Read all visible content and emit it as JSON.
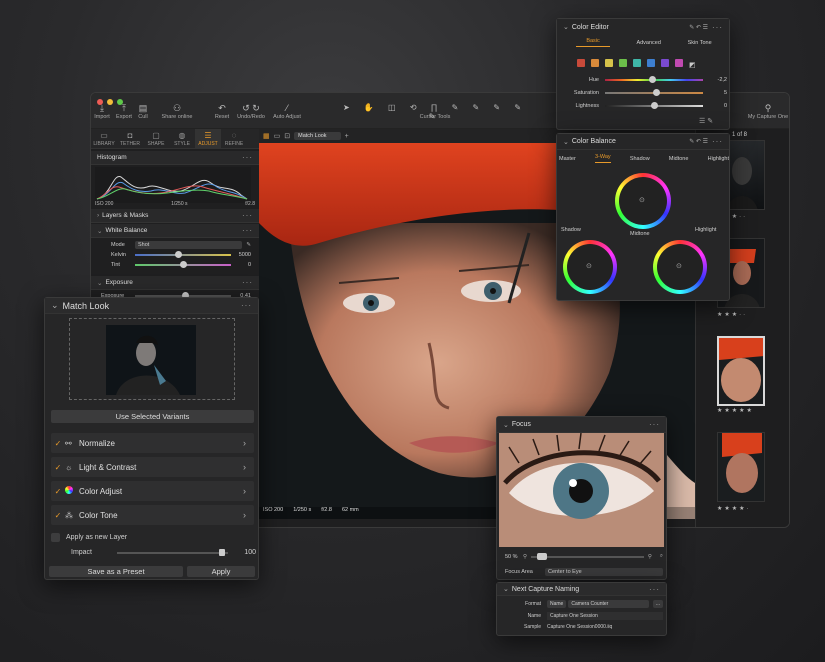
{
  "toolbar": {
    "import": "Import",
    "export": "Export",
    "cull": "Cull",
    "share": "Share online",
    "reset": "Reset",
    "undo_redo": "Undo/Redo",
    "auto_adjust": "Auto Adjust",
    "cursor_tools": "Cursor Tools",
    "my_capture_one": "My Capture One"
  },
  "tool_tabs": [
    "LIBRARY",
    "TETHER",
    "SHAPE",
    "STYLE",
    "ADJUST",
    "REFINE"
  ],
  "viewer_bar": {
    "match_look_select": "Match Look"
  },
  "histogram": {
    "title": "Histogram",
    "iso": "ISO 200",
    "shutter": "1/250 s",
    "aperture": "f/2.8"
  },
  "layers": {
    "title": "Layers & Masks"
  },
  "white_balance": {
    "title": "White Balance",
    "mode_label": "Mode",
    "mode_value": "Shot",
    "kelvin_label": "Kelvin",
    "kelvin_value": "5000",
    "kelvin_level": 0.45,
    "tint_label": "Tint",
    "tint_value": "0",
    "tint_level": 0.5
  },
  "exposure": {
    "title": "Exposure",
    "label": "Exposure",
    "value": "0,41",
    "level": 0.52
  },
  "match_look": {
    "title": "Match Look",
    "use_variants": "Use Selected Variants",
    "items": [
      {
        "label": "Normalize",
        "icon": "normalize-icon"
      },
      {
        "label": "Light & Contrast",
        "icon": "sun-icon"
      },
      {
        "label": "Color Adjust",
        "icon": "color-wheel-icon"
      },
      {
        "label": "Color Tone",
        "icon": "color-tone-icon"
      }
    ],
    "apply_layer": "Apply as new Layer",
    "impact_label": "Impact",
    "impact_value": "100",
    "impact_level": 0.95,
    "save_preset": "Save as a Preset",
    "apply": "Apply"
  },
  "viewer_status": {
    "iso": "ISO 200",
    "shutter": "1/250 s",
    "aperture": "f/2.8",
    "focal": "62 mm"
  },
  "color_editor": {
    "title": "Color Editor",
    "tabs": [
      "Basic",
      "Advanced",
      "Skin Tone"
    ],
    "swatches": [
      "#c84a3a",
      "#d98a3a",
      "#d6c24a",
      "#6cbf4a",
      "#3fb7a8",
      "#3d7fd0",
      "#7a4ad0",
      "#c04ab0"
    ],
    "hue_label": "Hue",
    "hue_value": "-2,2",
    "hue_level": 0.48,
    "sat_label": "Saturation",
    "sat_value": "5",
    "sat_level": 0.52,
    "light_label": "Lightness",
    "light_value": "0",
    "light_level": 0.5
  },
  "color_balance": {
    "title": "Color Balance",
    "tabs": [
      "Master",
      "3-Way",
      "Shadow",
      "Midtone",
      "Highlight"
    ],
    "shadow": "Shadow",
    "midtone": "Midtone",
    "highlight": "Highlight"
  },
  "browser": {
    "count": "1 of 8"
  },
  "focus": {
    "title": "Focus",
    "zoom": "50 %",
    "focus_area_label": "Focus Area",
    "focus_area_value": "Center to Eye"
  },
  "naming": {
    "title": "Next Capture Naming",
    "format_label": "Format",
    "format_token1": "Name",
    "format_token2": "Camera Counter",
    "format_more": "...",
    "name_label": "Name",
    "name_value": "Capture One Session",
    "sample_label": "Sample",
    "sample_value": "Capture One Session0000.iiq"
  }
}
